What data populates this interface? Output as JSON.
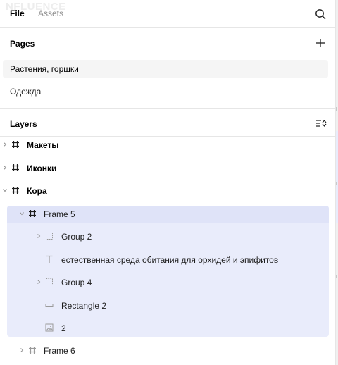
{
  "watermark": "NFLUENCE",
  "tabs": {
    "file": "File",
    "assets": "Assets"
  },
  "icons": {
    "search": "search-icon",
    "add": "plus-icon",
    "sort": "sort-list-icon",
    "frame": "hash-frame-icon",
    "group": "dashed-group-icon",
    "text": "text-icon",
    "rectangle": "rectangle-icon",
    "image": "image-icon",
    "chevron_right": "chevron-right-icon",
    "chevron_down": "chevron-down-icon"
  },
  "pages": {
    "title": "Pages",
    "items": [
      {
        "label": "Растения, горшки",
        "selected": true
      },
      {
        "label": "Одежда",
        "selected": false
      }
    ]
  },
  "layers": {
    "title": "Layers",
    "items": [
      {
        "label": "Макеты",
        "type": "frame",
        "expanded": false,
        "bold": true
      },
      {
        "label": "Иконки",
        "type": "frame",
        "expanded": false,
        "bold": true
      },
      {
        "label": "Кора",
        "type": "frame",
        "expanded": true,
        "bold": true
      },
      {
        "label": "Frame 5",
        "type": "frame",
        "expanded": true,
        "bold": false,
        "selected": true
      },
      {
        "label": "Group 2",
        "type": "group",
        "expanded": false,
        "bold": false
      },
      {
        "label": "естественная среда обитания для орхидей и эпифитов",
        "type": "text",
        "bold": false
      },
      {
        "label": "Group 4",
        "type": "group",
        "expanded": false,
        "bold": false
      },
      {
        "label": "Rectangle 2",
        "type": "rectangle",
        "bold": false
      },
      {
        "label": "2",
        "type": "image",
        "bold": false
      },
      {
        "label": "Frame 6",
        "type": "frame",
        "expanded": false,
        "bold": false
      }
    ]
  },
  "colors": {
    "selection": "#e9ecfb",
    "selection_head": "#dfe3f8",
    "page_selected": "#f5f5f5"
  }
}
